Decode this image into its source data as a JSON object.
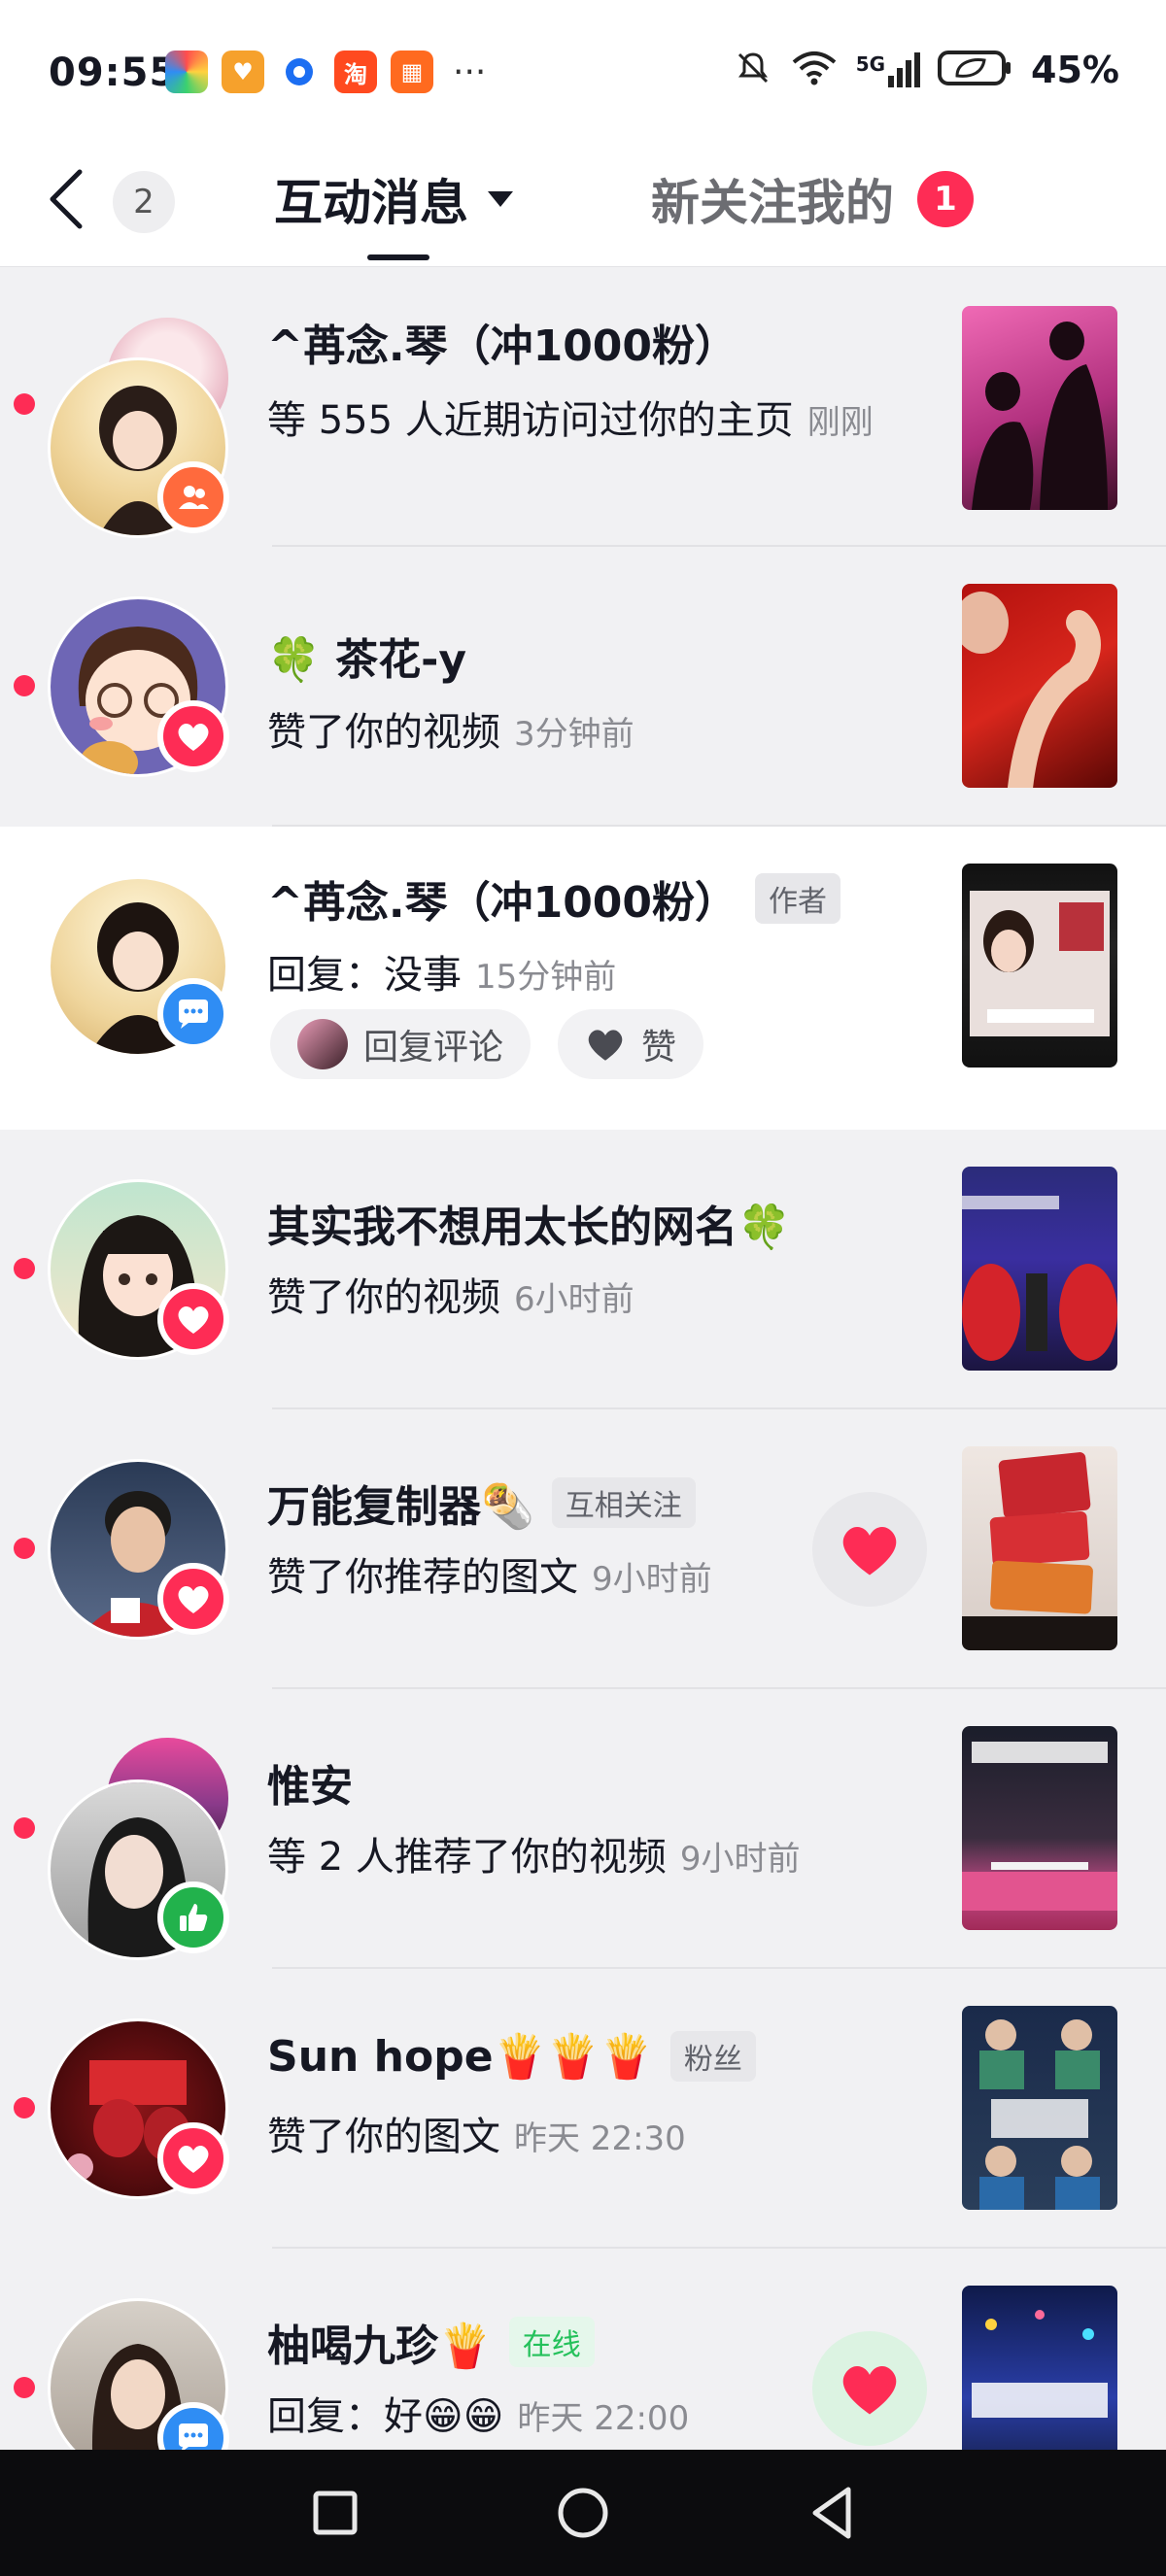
{
  "status_bar": {
    "time": "09:55",
    "apps": [
      {
        "icon": "color-wheel-app-icon",
        "color": "#1a9fd8",
        "glyph": "◐"
      },
      {
        "icon": "heart-app-icon",
        "color": "#f6a12c",
        "glyph": "♥"
      },
      {
        "icon": "blue-ring-app-icon",
        "color": "#1c6ef2",
        "glyph": "●"
      },
      {
        "icon": "taobao-app-icon",
        "color": "#ff4a1f",
        "glyph": "淘"
      },
      {
        "icon": "grid-app-icon",
        "color": "#ff6a1f",
        "glyph": "▦"
      }
    ],
    "more": "···",
    "network": "5G",
    "battery": "45%"
  },
  "header": {
    "unread_count": "2",
    "tab_active": "互动消息",
    "tab_inactive": "新关注我的",
    "tab_inactive_badge": "1"
  },
  "notifications": [
    {
      "name": "^苒念.琴（冲1000粉）",
      "tag": "",
      "action": "等 555 人近期访问过你的主页",
      "time": "刚刚",
      "type": "visitors",
      "badge_icon": "people-icon",
      "badge_color": "#ff6a3d",
      "unread": true,
      "stacked": true
    },
    {
      "name": "🍀  茶花-y",
      "tag": "",
      "action": "赞了你的视频",
      "time": "3分钟前",
      "type": "like",
      "badge_icon": "heart-icon",
      "badge_color": "#fe2c55",
      "unread": true,
      "stacked": false
    },
    {
      "name": "^苒念.琴（冲1000粉）",
      "tag": "作者",
      "action": "回复：没事",
      "time": "15分钟前",
      "type": "reply",
      "badge_icon": "comment-icon",
      "badge_color": "#2f8df4",
      "unread": false,
      "stacked": false,
      "reply_label": "回复评论",
      "like_label": "赞"
    },
    {
      "name": "其实我不想用太长的网名🍀",
      "tag": "",
      "action": "赞了你的视频",
      "time": "6小时前",
      "type": "like",
      "badge_icon": "heart-icon",
      "badge_color": "#fe2c55",
      "unread": true,
      "stacked": false
    },
    {
      "name": "万能复制器🌯",
      "tag": "互相关注",
      "action": "赞了你推荐的图文",
      "time": "9小时前",
      "type": "like",
      "badge_icon": "heart-icon",
      "badge_color": "#fe2c55",
      "unread": true,
      "stacked": false,
      "like_back": true
    },
    {
      "name": "惟安",
      "tag": "",
      "action": "等 2 人推荐了你的视频",
      "time": "9小时前",
      "type": "recommend",
      "badge_icon": "thumbs-up-icon",
      "badge_color": "#22b24c",
      "unread": true,
      "stacked": true
    },
    {
      "name": "Sun hope🍟🍟🍟",
      "tag": "粉丝",
      "action": "赞了你的图文",
      "time": "昨天 22:30",
      "type": "like",
      "badge_icon": "heart-icon",
      "badge_color": "#fe2c55",
      "unread": true,
      "stacked": false
    },
    {
      "name": "柚喝九珍🍟",
      "tag": "在线",
      "action": "回复：好😁😁",
      "time": "昨天 22:00",
      "type": "reply",
      "badge_icon": "comment-icon",
      "badge_color": "#2f8df4",
      "unread": true,
      "stacked": false,
      "like_back": true
    }
  ],
  "nav_bar": {
    "buttons": [
      "recent-apps-icon",
      "home-icon",
      "back-icon"
    ]
  }
}
